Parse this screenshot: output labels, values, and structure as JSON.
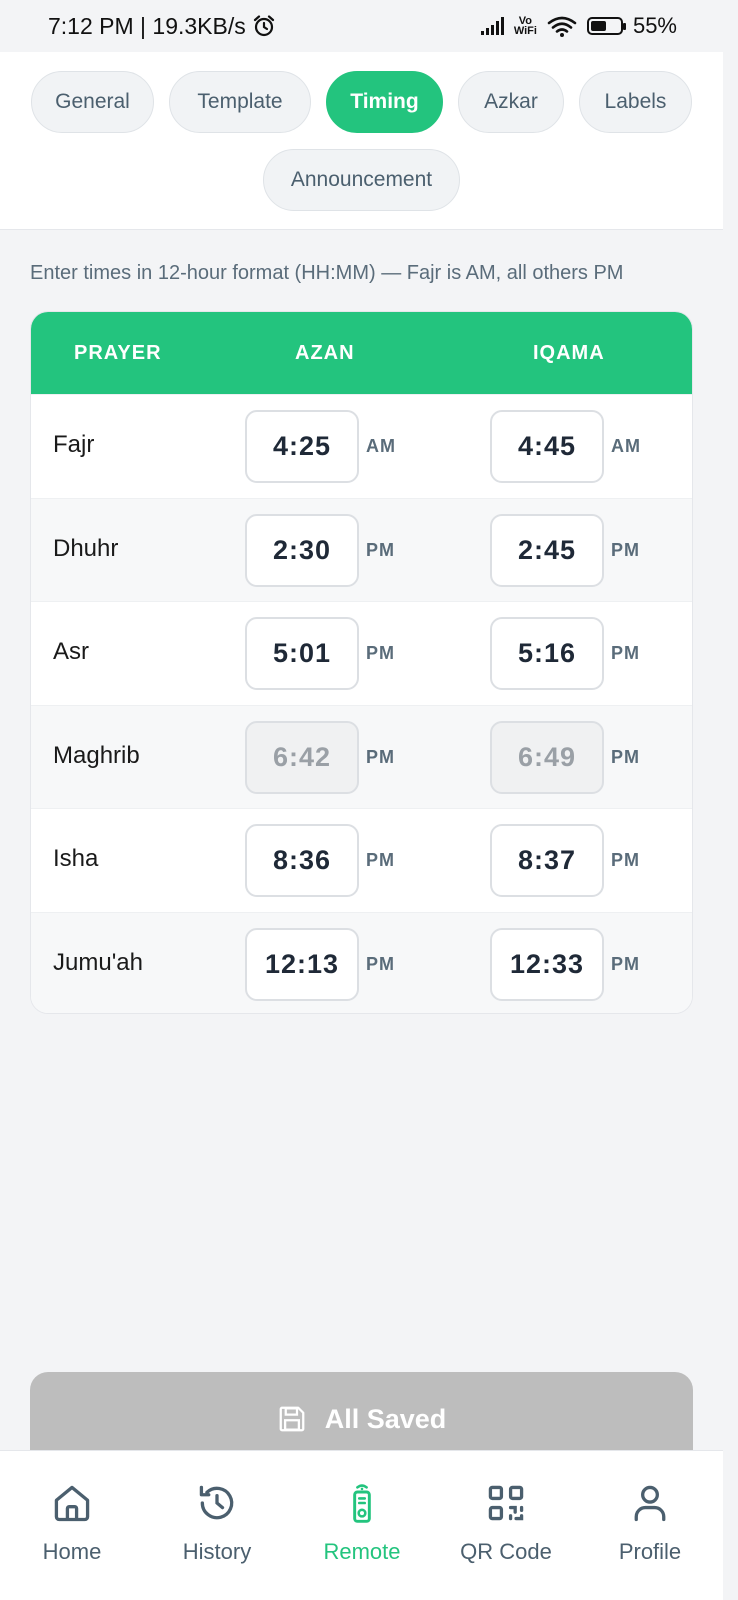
{
  "status_bar": {
    "time": "7:12 PM | 19.3KB/s",
    "vo_line1": "Vo",
    "vo_line2": "WiFi",
    "battery": "55%"
  },
  "tabs": [
    {
      "label": "General",
      "active": false
    },
    {
      "label": "Template",
      "active": false
    },
    {
      "label": "Timing",
      "active": true
    },
    {
      "label": "Azkar",
      "active": false
    },
    {
      "label": "Labels",
      "active": false
    },
    {
      "label": "Announcement",
      "active": false
    }
  ],
  "hint": "Enter times in 12-hour format (HH:MM) — Fajr is AM, all others PM",
  "table": {
    "headers": [
      "PRAYER",
      "AZAN",
      "IQAMA"
    ],
    "rows": [
      {
        "name": "Fajr",
        "azan": "4:25",
        "azan_period": "AM",
        "iqama": "4:45",
        "iqama_period": "AM",
        "disabled": false
      },
      {
        "name": "Dhuhr",
        "azan": "2:30",
        "azan_period": "PM",
        "iqama": "2:45",
        "iqama_period": "PM",
        "disabled": false
      },
      {
        "name": "Asr",
        "azan": "5:01",
        "azan_period": "PM",
        "iqama": "5:16",
        "iqama_period": "PM",
        "disabled": false
      },
      {
        "name": "Maghrib",
        "azan": "6:42",
        "azan_period": "PM",
        "iqama": "6:49",
        "iqama_period": "PM",
        "disabled": true
      },
      {
        "name": "Isha",
        "azan": "8:36",
        "azan_period": "PM",
        "iqama": "8:37",
        "iqama_period": "PM",
        "disabled": false
      },
      {
        "name": "Jumu'ah",
        "azan": "12:13",
        "azan_period": "PM",
        "iqama": "12:33",
        "iqama_period": "PM",
        "disabled": false
      }
    ]
  },
  "save_button": {
    "label": "All Saved",
    "icon": "save-icon"
  },
  "bottom_nav": [
    {
      "label": "Home",
      "icon": "home-icon",
      "active": false
    },
    {
      "label": "History",
      "icon": "history-icon",
      "active": false
    },
    {
      "label": "Remote",
      "icon": "remote-icon",
      "active": true
    },
    {
      "label": "QR Code",
      "icon": "qr-code-icon",
      "active": false
    },
    {
      "label": "Profile",
      "icon": "profile-icon",
      "active": false
    }
  ],
  "colors": {
    "accent": "#23c47e",
    "disabled": "#bdbdbd"
  }
}
